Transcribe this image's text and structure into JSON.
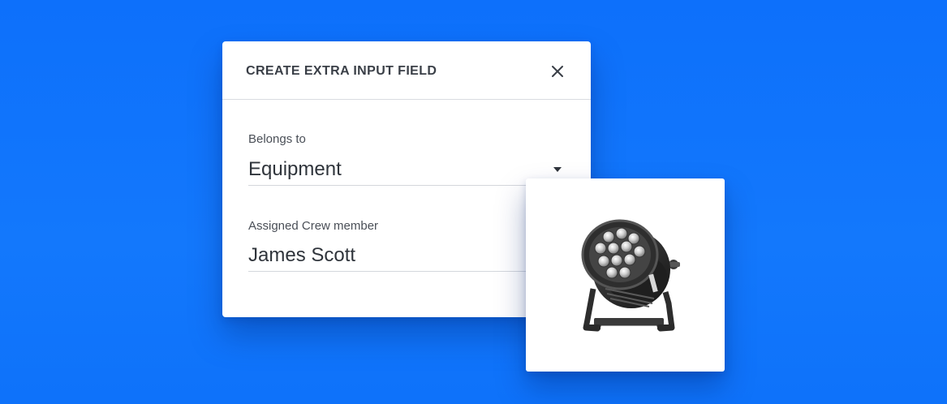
{
  "dialog": {
    "title": "CREATE EXTRA INPUT FIELD",
    "close_icon": "close-icon",
    "belongs_to": {
      "label": "Belongs to",
      "value": "Equipment",
      "icon": "caret-down-icon"
    },
    "assigned_crew": {
      "label": "Assigned Crew member",
      "value": "James Scott"
    }
  },
  "image_card": {
    "image": "led-par-light-fixture"
  },
  "colors": {
    "background": "#0f74fb",
    "card": "#ffffff",
    "title_text": "#3a3f47",
    "divider": "#d9dce1"
  }
}
